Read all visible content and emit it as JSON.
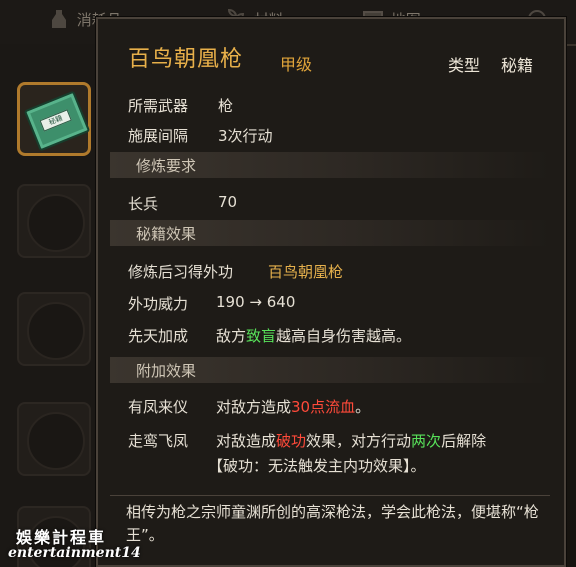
{
  "tabs": [
    {
      "label": "消耗品",
      "icon": "potion-icon"
    },
    {
      "label": "材料",
      "icon": "herb-icon"
    },
    {
      "label": "地图",
      "icon": "map-icon"
    },
    {
      "label": "",
      "icon": "compass-icon"
    }
  ],
  "item": {
    "name": "百鸟朝凰枪",
    "grade": "甲级",
    "type_label": "类型",
    "type_value": "秘籍",
    "weapon_label": "所需武器",
    "weapon_value": "枪",
    "interval_label": "施展间隔",
    "interval_value": "3次行动"
  },
  "sections": {
    "requirement": "修炼要求",
    "effect": "秘籍效果",
    "extra": "附加效果"
  },
  "requirement": {
    "label": "长兵",
    "value": "70"
  },
  "effect": {
    "learn_label": "修炼后习得外功",
    "learn_value": "百鸟朝凰枪",
    "power_label": "外功威力",
    "power_value": "190 → 640",
    "innate_label": "先天加成",
    "innate_pre": "敌方",
    "innate_hl": "致盲",
    "innate_post": "越高自身伤害越高。"
  },
  "extra": {
    "e1_label": "有凤来仪",
    "e1_pre": "对敌方造成",
    "e1_hl": "30点流血",
    "e1_post": "。",
    "e2_label": "走鸾飞凤",
    "e2_pre": "对敌造成",
    "e2_hl1": "破功",
    "e2_mid": "效果，对方行动",
    "e2_hl2": "两次",
    "e2_post": "后解除",
    "e2_note": "【破功：无法触发主内功效果】。"
  },
  "description": "相传为枪之宗师童渊所创的高深枪法，学会此枪法，便堪称“枪王”。",
  "watermark": {
    "line1": "娛樂計程車",
    "line2": "entertainment14"
  },
  "colors": {
    "title": "#e8b04a",
    "highlight_green": "#58e25a",
    "highlight_red": "#ff4a3a",
    "frame": "#4a423a"
  }
}
